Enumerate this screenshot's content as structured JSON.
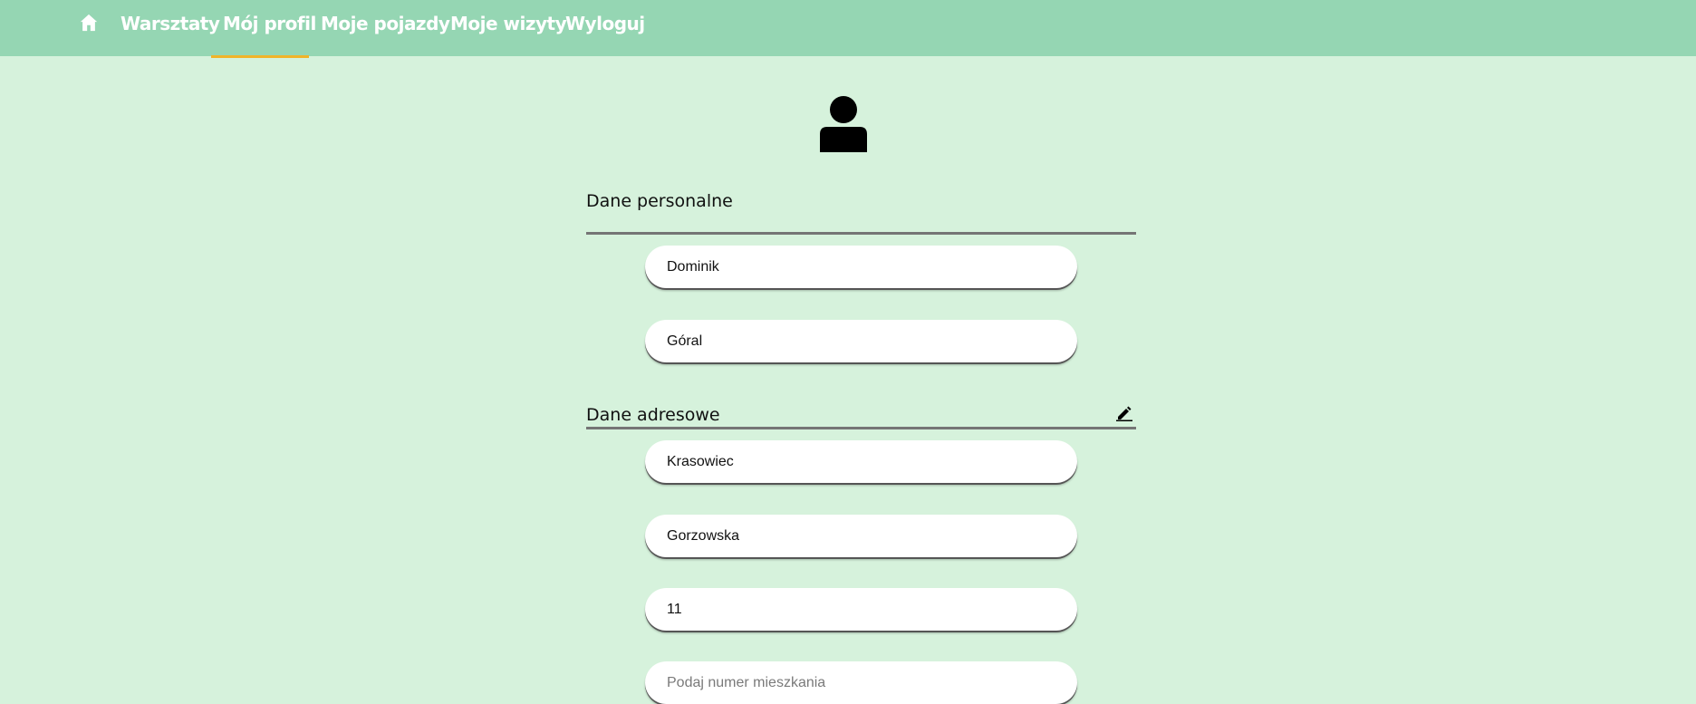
{
  "nav": {
    "home_icon": "home-icon",
    "items": [
      {
        "label": "Warsztaty"
      },
      {
        "label": "Mój profil"
      },
      {
        "label": "Moje pojazdy"
      },
      {
        "label": "Moje wizyty"
      },
      {
        "label": "Wyloguj"
      }
    ],
    "active_index": 1,
    "active_color": "#f0b429",
    "background": "#95d6b3"
  },
  "profile": {
    "avatar_icon": "user-icon",
    "personal": {
      "title": "Dane personalne",
      "first_name": {
        "value": "Dominik"
      },
      "last_name": {
        "value": "Góral"
      }
    },
    "address": {
      "title": "Dane adresowe",
      "edit_icon": "pencil-icon",
      "city": {
        "value": "Krasowiec"
      },
      "street": {
        "value": "Gorzowska"
      },
      "house_number": {
        "value": "11"
      },
      "apartment_number": {
        "value": "",
        "placeholder": "Podaj numer mieszkania"
      }
    }
  },
  "colors": {
    "page_background": "#d6f2dc"
  }
}
